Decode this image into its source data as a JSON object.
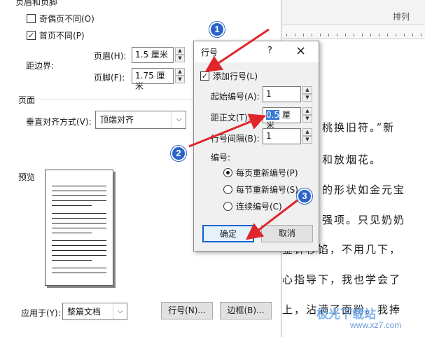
{
  "page_setup": {
    "header_footer_heading": "页眉和页脚",
    "odd_even_label": "奇偶页不同(O)",
    "odd_even_checked": false,
    "first_page_label": "首页不同(P)",
    "first_page_checked": true,
    "from_edge_label": "距边界:",
    "header_label": "页眉(H):",
    "header_value": "1.5 厘米",
    "footer_label": "页脚(F):",
    "footer_value": "1.75 厘米",
    "page_heading": "页面",
    "vertical_align_label": "垂直对齐方式(V):",
    "vertical_align_value": "顶端对齐",
    "preview_heading": "预览",
    "apply_to_label": "应用于(Y):",
    "apply_to_value": "整篇文档",
    "line_numbers_button": "行号(N)...",
    "borders_button": "边框(B)..."
  },
  "document": {
    "ribbon_label": "排列",
    "lines": [
      "桃换旧符。”新",
      "和放烟花。",
      "的形状如金元宝",
      "强项。只见奶奶",
      "金针移馅，不用几下，",
      "心指导下，我也学会了",
      "上，沾满了面粉。我捧"
    ]
  },
  "line_numbers_dialog": {
    "title": "行号",
    "help": "?",
    "close": "×",
    "add_line_numbers_label": "添加行号(L)",
    "add_line_numbers_checked": true,
    "start_at_label": "起始编号(A):",
    "start_at_value": "1",
    "from_text_label": "距正文(T):",
    "from_text_number": "0.5",
    "from_text_unit": " 厘米",
    "count_by_label": "行号间隔(B):",
    "count_by_value": "1",
    "numbering_heading": "编号:",
    "numbering_options": [
      {
        "label": "每页重新编号(P)",
        "selected": true
      },
      {
        "label": "每节重新编号(S)",
        "selected": false
      },
      {
        "label": "连续编号(C)",
        "selected": false
      }
    ],
    "ok_button": "确定",
    "cancel_button": "取消"
  },
  "annotations": {
    "step1": "1",
    "step2": "2",
    "step3": "3",
    "arrow_color": "#e0262b",
    "badge_color": "#2b63c9"
  },
  "watermark": {
    "text": "极光下载站",
    "url": "www.xz7.com"
  }
}
